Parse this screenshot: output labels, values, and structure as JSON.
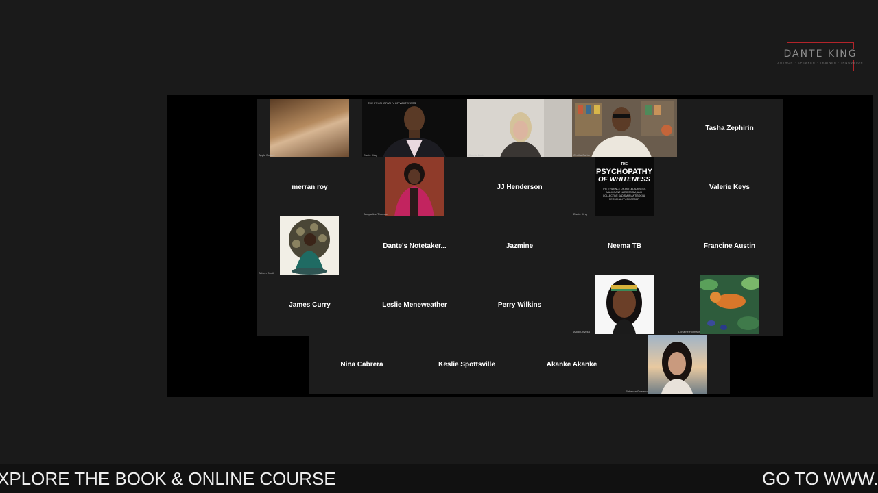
{
  "logo": {
    "name": "DANTE KING",
    "tagline": "AUTHOR · SPEAKER · TRAINER · INNOVATOR",
    "accent": "#b3242a"
  },
  "meeting": {
    "video_captions": {
      "apple": "Apple Dalzell",
      "dante_book": "THE PSYCHOPATHY OF WHITENESS",
      "dante": "Dante King",
      "blonde": "Ginette Bolin",
      "glasses": "Cecilia Carter",
      "jacqueline": "Jacqueline Thomas",
      "book_owner": "Dante King",
      "afro": "Allison Smith",
      "headband": "Adidi Onyeka",
      "tiger": "Lorraine Hofmann",
      "bottom": "Rebecca Guerrero"
    },
    "book": {
      "the": "THE",
      "title1": "PSYCHOPATHY",
      "title2": "OF WHITENESS",
      "subtitle": "THE EVIDENCE OF ANTI-BLACKNESS, MALIGNANT NARCISSISM, AND COLLECTIVE SADISM IN ANTISOCIAL PERSONALITY DISORDER"
    },
    "names": {
      "tasha": "Tasha Zephirin",
      "merran": "merran roy",
      "jj": "JJ Henderson",
      "valerie": "Valerie Keys",
      "notetaker": "Dante's  Notetaker...",
      "jazmine": "Jazmine",
      "neema": "Neema TB",
      "francine": "Francine Austin",
      "james": "James Curry",
      "leslie": "Leslie Meneweather",
      "perry": "Perry Wilkins",
      "nina": "Nina Cabrera",
      "keslie": "Keslie Spottsville",
      "akanke": "Akanke Akanke"
    }
  },
  "banner": {
    "left_text": "XPLORE THE BOOK & ONLINE COURSE",
    "right_text": "GO TO WWW.D"
  }
}
